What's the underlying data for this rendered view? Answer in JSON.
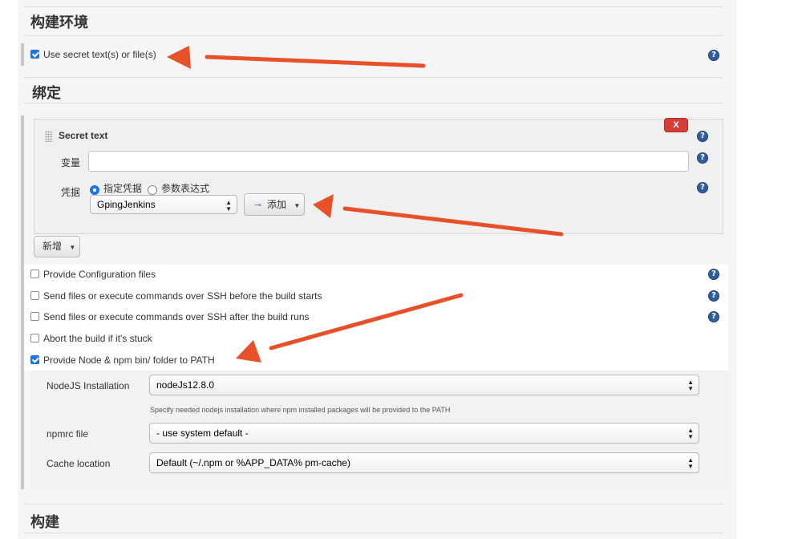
{
  "build_env": {
    "title": "构建环境",
    "use_secret_label": "Use secret text(s) or file(s)",
    "use_secret_checked": true
  },
  "bindings": {
    "title": "绑定",
    "secret_text": {
      "title": "Secret text",
      "delete_label": "X",
      "variable_label": "变量",
      "variable_value": "",
      "credentials_label": "凭据",
      "radio_specific": "指定凭据",
      "radio_param": "参数表达式",
      "credential_selected": "GpingJenkins",
      "add_label": "添加"
    },
    "add_new_label": "新增"
  },
  "options": [
    {
      "label": "Provide Configuration files",
      "checked": false
    },
    {
      "label": "Send files or execute commands over SSH before the build starts",
      "checked": false
    },
    {
      "label": "Send files or execute commands over SSH after the build runs",
      "checked": false
    },
    {
      "label": "Abort the build if it's stuck",
      "checked": false
    },
    {
      "label": "Provide Node & npm bin/ folder to PATH",
      "checked": true
    }
  ],
  "node": {
    "installation_label": "NodeJS Installation",
    "installation_value": "nodeJs12.8.0",
    "installation_hint": "Specify needed nodejs installation where npm installed packages will be provided to the PATH",
    "npmrc_label": "npmrc file",
    "npmrc_value": "- use system default -",
    "cache_label": "Cache location",
    "cache_value": "Default (~/.npm or %APP_DATA% pm-cache)"
  },
  "build": {
    "title": "构建"
  },
  "colors": {
    "accent_arrow": "#e8502a",
    "help_icon": "#2f5f9e",
    "delete_button": "#c9302c",
    "checkbox_checked": "#1e79e6"
  }
}
